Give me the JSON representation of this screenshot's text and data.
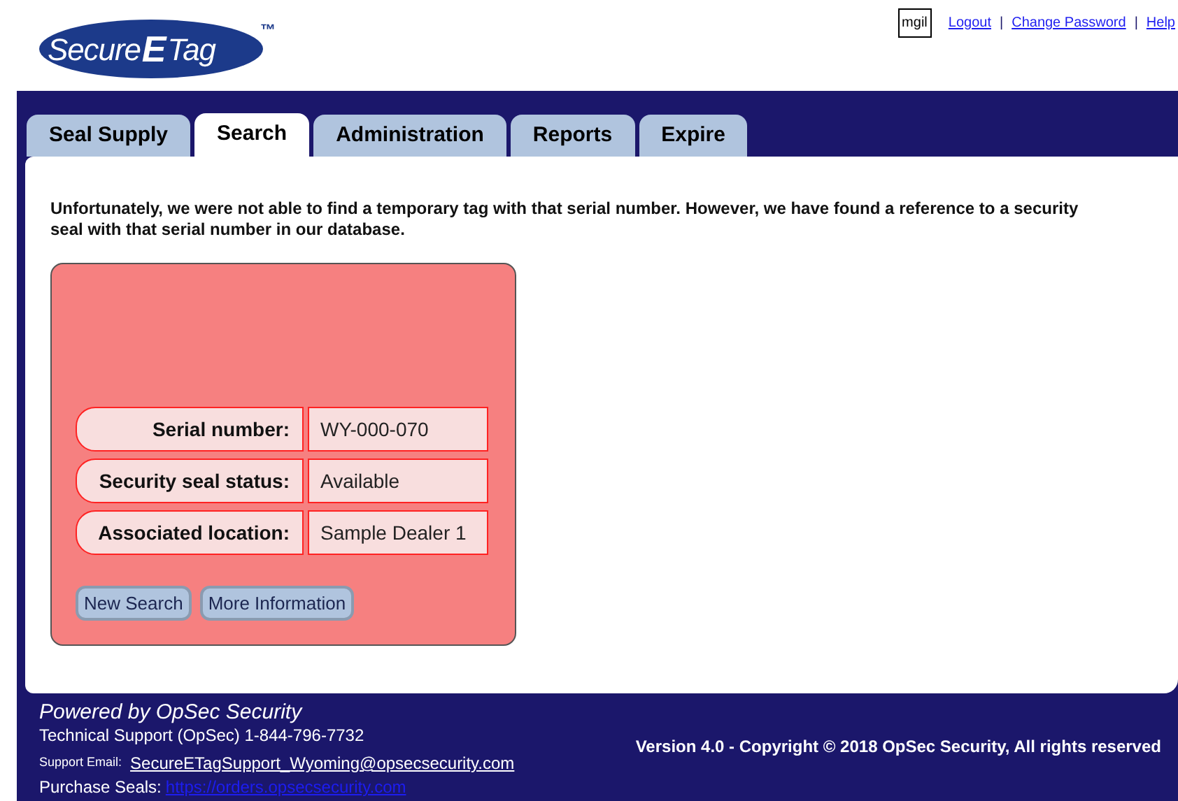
{
  "logo": {
    "part_1": "Secure",
    "part_2": "E",
    "part_3": "Tag",
    "mark": "™"
  },
  "user_links": {
    "user": "mgil",
    "links": [
      "Logout",
      "Change Password",
      "Help"
    ],
    "separator": "|"
  },
  "tabs": [
    {
      "label": "Seal Supply",
      "selected": false
    },
    {
      "label": "Search",
      "selected": true
    },
    {
      "label": "Administration",
      "selected": false
    },
    {
      "label": "Reports",
      "selected": false
    },
    {
      "label": "Expire",
      "selected": false
    }
  ],
  "message": "Unfortunately, we were not able to find a temporary tag with that serial number. However, we have found a reference to a security seal with that serial number in our database.",
  "details": [
    {
      "label": "Serial number:",
      "value": "WY-000-070"
    },
    {
      "label": "Security seal status:",
      "value": "Available"
    },
    {
      "label": "Associated location:",
      "value": "Sample Dealer 1"
    }
  ],
  "buttons": [
    "New Search",
    "More Information"
  ],
  "footer": {
    "powered_by": "Powered by OpSec Security",
    "tech_support": "Technical Support (OpSec) 1-844-796-7732",
    "email_label": "Support Email:",
    "email": "SecureETagSupport_Wyoming@opsecsecurity.com",
    "purchase_label": "Purchase Seals:",
    "purchase_link": "https://orders.opsecsecurity.com",
    "version": "Version 4.0 - Copyright © 2018 OpSec Security, All rights reserved"
  }
}
